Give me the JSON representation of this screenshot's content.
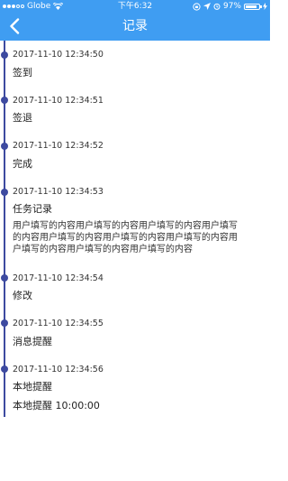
{
  "status_bar": {
    "carrier": "Globe",
    "time": "下午6:32",
    "battery": "97%"
  },
  "nav": {
    "title": "记录"
  },
  "records": [
    {
      "timestamp": "2017-11-10 12:34:50",
      "title": "签到"
    },
    {
      "timestamp": "2017-11-10 12:34:51",
      "title": "签退"
    },
    {
      "timestamp": "2017-11-10 12:34:52",
      "title": "完成"
    },
    {
      "timestamp": "2017-11-10 12:34:53",
      "title": "任务记录",
      "detail_lines": [
        "用户填写的内容用户填写的内容用户填写的内容用户填写",
        "的内容用户填写的内容用户填写的内容用户填写的内容用",
        "户填写的内容用户填写的内容用户填写的内容"
      ]
    },
    {
      "timestamp": "2017-11-10 12:34:54",
      "title": "修改"
    },
    {
      "timestamp": "2017-11-10 12:34:55",
      "title": "消息提醒"
    },
    {
      "timestamp": "2017-11-10 12:34:56",
      "title": "本地提醒",
      "detail": "本地提醒 10:00:00"
    }
  ],
  "colors": {
    "header_bg": "#3f9df2",
    "timeline": "#3d4aa0"
  }
}
